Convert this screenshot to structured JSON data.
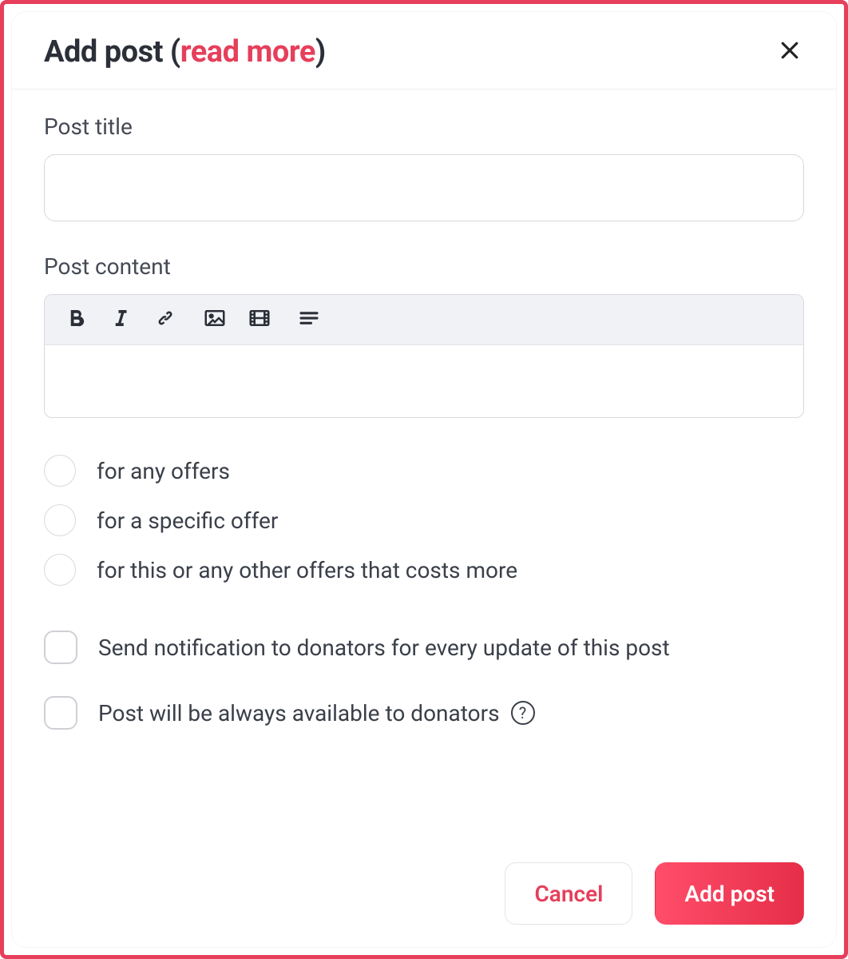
{
  "header": {
    "title_prefix": "Add post (",
    "title_link": "read more",
    "title_suffix": ")"
  },
  "fields": {
    "title_label": "Post title",
    "content_label": "Post content",
    "title_value": ""
  },
  "radios": [
    "for any offers",
    "for a specific offer",
    "for this or any other offers that costs more"
  ],
  "checks": [
    "Send notification to donators for every update of this post",
    "Post will be always available to donators"
  ],
  "help_glyph": "?",
  "footer": {
    "cancel": "Cancel",
    "submit": "Add post"
  }
}
